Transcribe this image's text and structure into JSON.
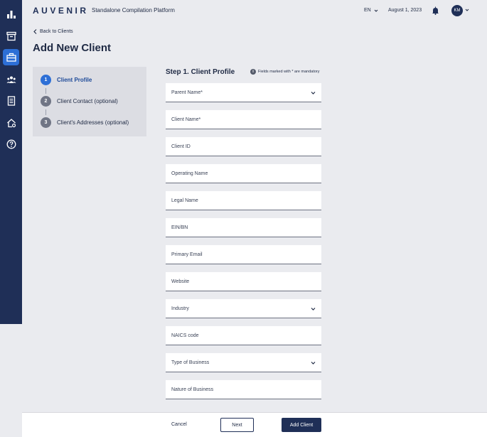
{
  "header": {
    "logo": "AUVENIR",
    "platform": "Standalone Compilation Platform",
    "language": "EN",
    "date": "August 1, 2023",
    "user_initials": "KM"
  },
  "sidebar": {
    "items": [
      {
        "icon": "bar-chart-icon",
        "active": false
      },
      {
        "icon": "archive-icon",
        "active": false
      },
      {
        "icon": "briefcase-icon",
        "active": true
      },
      {
        "icon": "users-icon",
        "active": false
      },
      {
        "icon": "document-list-icon",
        "active": false
      },
      {
        "icon": "home-settings-icon",
        "active": false
      },
      {
        "icon": "help-icon",
        "active": false
      }
    ]
  },
  "nav": {
    "back_label": "Back to Clients"
  },
  "page": {
    "title": "Add New Client"
  },
  "stepper": {
    "steps": [
      {
        "number": "1",
        "label": "Client Profile",
        "active": true
      },
      {
        "number": "2",
        "label": "Client Contact (optional)",
        "active": false
      },
      {
        "number": "3",
        "label": "Client's Addresses (optional)",
        "active": false
      }
    ]
  },
  "form": {
    "title": "Step 1. Client Profile",
    "mandatory_note": "Fields marked with * are mandatory",
    "fields": [
      {
        "label": "Parent Name*",
        "type": "select"
      },
      {
        "label": "Client Name*",
        "type": "text"
      },
      {
        "label": "Client ID",
        "type": "text"
      },
      {
        "label": "Operating Name",
        "type": "text"
      },
      {
        "label": "Legal Name",
        "type": "text"
      },
      {
        "label": "EIN/BN",
        "type": "text"
      },
      {
        "label": "Primary Email",
        "type": "text"
      },
      {
        "label": "Website",
        "type": "text"
      },
      {
        "label": "Industry",
        "type": "select"
      },
      {
        "label": "NAICS code",
        "type": "text"
      },
      {
        "label": "Type of Business",
        "type": "select"
      },
      {
        "label": "Nature of Business",
        "type": "text"
      }
    ]
  },
  "footer": {
    "cancel_label": "Cancel",
    "next_label": "Next",
    "add_label": "Add Client"
  },
  "colors": {
    "sidebar_bg": "#1f2f57",
    "accent": "#2d6fd6",
    "page_bg": "#eaebef"
  }
}
